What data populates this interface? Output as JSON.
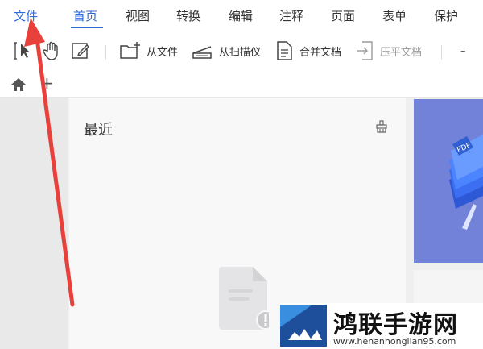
{
  "menu": {
    "file": "文件",
    "items": [
      "首页",
      "视图",
      "转换",
      "编辑",
      "注释",
      "页面",
      "表单",
      "保护"
    ],
    "active_index": 0
  },
  "toolbar": {
    "from_file": "从文件",
    "from_scanner": "从扫描仪",
    "merge_docs": "合并文档",
    "compress_docs": "压平文档",
    "minus": "–"
  },
  "tabs": {
    "add": "+"
  },
  "recent": {
    "title": "最近"
  },
  "watermark": {
    "title": "鸿联手游网",
    "url": "www.henanhonglian95.com"
  },
  "colors": {
    "accent": "#2f6bd8",
    "arrow": "#e8403a",
    "promo": "#6f7fd6"
  },
  "icons": [
    "select-cursor-icon",
    "hand-icon",
    "edit-icon",
    "folder-plus-icon",
    "scanner-icon",
    "document-icon",
    "compress-icon",
    "home-icon",
    "clean-icon"
  ]
}
